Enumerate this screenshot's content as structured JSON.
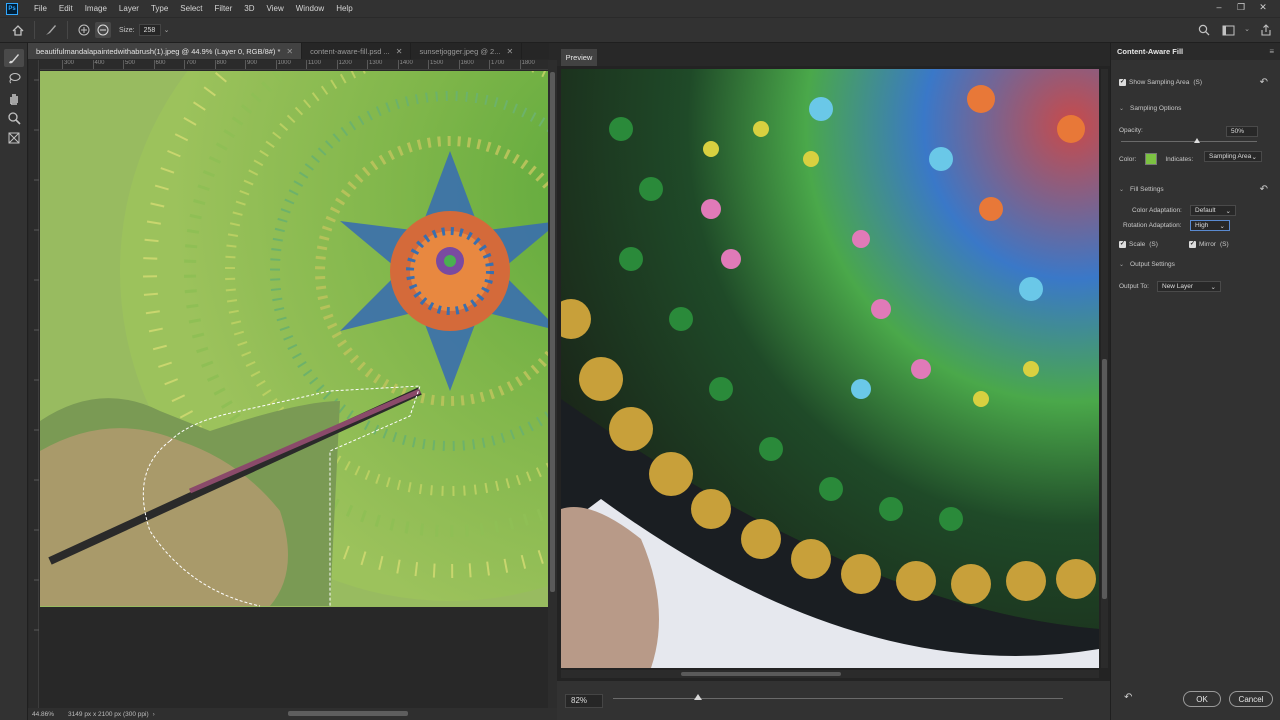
{
  "app": {
    "logo_label": "Ps",
    "menu": [
      "File",
      "Edit",
      "Image",
      "Layer",
      "Type",
      "Select",
      "Filter",
      "3D",
      "View",
      "Window",
      "Help"
    ]
  },
  "options_bar": {
    "size_label": "Size:",
    "size_value": "258"
  },
  "tabs": [
    {
      "label": "beautifulmandalapaintedwithabrush(1).jpeg @ 44.9% (Layer 0, RGB/8#) *",
      "active": true
    },
    {
      "label": "content-aware-fill.psd ...",
      "active": false
    },
    {
      "label": "sunsetjogger.jpeg @ 2...",
      "active": false
    }
  ],
  "ruler": {
    "h_ticks": [
      "300",
      "400",
      "500",
      "600",
      "700",
      "800",
      "900",
      "1000",
      "1100",
      "1200",
      "1300",
      "1400",
      "1500",
      "1600",
      "1700",
      "1800"
    ]
  },
  "status": {
    "zoom": "44.86%",
    "doc_info": "3149 px x 2100 px (300 ppi)"
  },
  "preview": {
    "tab_label": "Preview",
    "zoom": "82%",
    "zoom_level": 0.18
  },
  "panel": {
    "title": "Content-Aware Fill",
    "show_sampling_area": "Show Sampling Area",
    "show_sampling_shortcut": "(S)",
    "sampling_options": "Sampling Options",
    "opacity_label": "Opacity:",
    "opacity_value": "50%",
    "opacity_fraction": 0.5,
    "color_label": "Color:",
    "color_swatch": "#7cc242",
    "indicates_label": "Indicates:",
    "indicates_value": "Sampling Area",
    "fill_settings": "Fill Settings",
    "color_adaptation_label": "Color Adaptation:",
    "color_adaptation_value": "Default",
    "rotation_adaptation_label": "Rotation Adaptation:",
    "rotation_adaptation_value": "High",
    "scale_label": "Scale",
    "scale_shortcut": "(S)",
    "mirror_label": "Mirror",
    "mirror_shortcut": "(S)",
    "output_settings": "Output Settings",
    "output_to_label": "Output To:",
    "output_to_value": "New Layer",
    "ok": "OK",
    "cancel": "Cancel"
  }
}
